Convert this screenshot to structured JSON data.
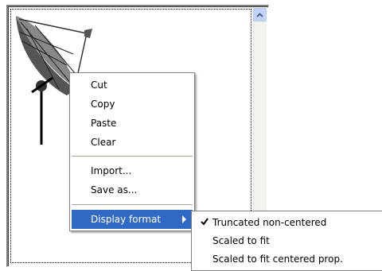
{
  "context_menu": {
    "items": [
      "Cut",
      "Copy",
      "Paste",
      "Clear"
    ],
    "file_items": [
      "Import...",
      "Save as..."
    ],
    "display_format": "Display format"
  },
  "submenu": {
    "items": [
      "Truncated non-centered",
      "Scaled to fit",
      "Scaled to fit centered prop."
    ],
    "checked_item": "Truncated non-centered"
  },
  "icons": {
    "scroll_up": "chevron-up-icon",
    "submenu_arrow": "chevron-right-icon",
    "checkmark": "checkmark-icon"
  }
}
